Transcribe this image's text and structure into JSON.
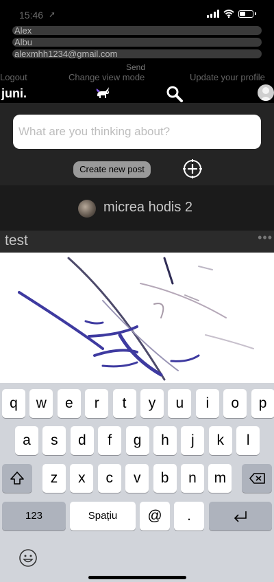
{
  "status": {
    "time": "15:46",
    "arrow": "➚"
  },
  "profile": {
    "first_name": "Alex",
    "last_name": "Albu",
    "email": "alexmhh1234@gmail.com",
    "send_label": "Send",
    "logout_label": "Logout",
    "change_view_label": "Change view mode",
    "update_profile_label": "Update your profile"
  },
  "header": {
    "logo": "juni."
  },
  "composer": {
    "placeholder": "What are you thinking about?",
    "create_label": "Create new post"
  },
  "post": {
    "author": "micrea hodis 2",
    "title": "test",
    "more": "•••"
  },
  "keyboard": {
    "row1": [
      "q",
      "w",
      "e",
      "r",
      "t",
      "y",
      "u",
      "i",
      "o",
      "p"
    ],
    "row2": [
      "a",
      "s",
      "d",
      "f",
      "g",
      "h",
      "j",
      "k",
      "l"
    ],
    "row3": [
      "z",
      "x",
      "c",
      "v",
      "b",
      "n",
      "m"
    ],
    "numbers_label": "123",
    "space_label": "Spațiu",
    "at_label": "@",
    "dot_label": "."
  }
}
